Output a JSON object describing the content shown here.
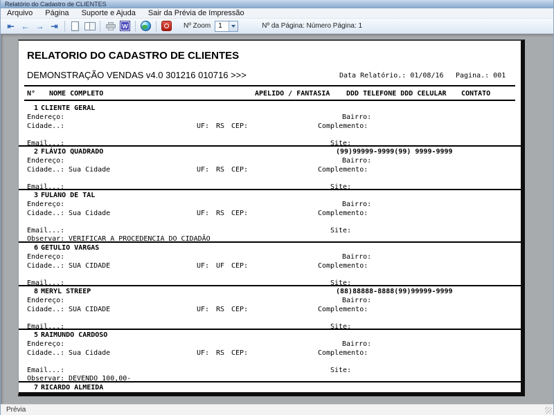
{
  "window": {
    "title": "Relatório do Cadastro de CLIENTES"
  },
  "menu": {
    "items": [
      "Arquivo",
      "Página",
      "Suporte e Ajuda",
      "Sair da Prévia de Impressão"
    ]
  },
  "toolbar": {
    "nav": {
      "first": "⇤",
      "prev": "←",
      "next": "→",
      "last": "⇥"
    },
    "word_letter": "W",
    "zoom_label": "Nº Zoom",
    "zoom_value": "1",
    "page_info": "Nº da Página: Número Página: 1"
  },
  "report": {
    "title": "RELATORIO DO CADASTRO DE CLIENTES",
    "subtitle": "DEMONSTRAÇÃO VENDAS v4.0 301216 010716 >>>",
    "date_label": "Data Relatório.: 01/08/16",
    "page_label": "Pagina.: 001",
    "columns": {
      "num": "N°",
      "nome": "NOME COMPLETO",
      "apelido": "APELIDO / FANTASIA",
      "telefone": "DDD TELEFONE DDD CELULAR",
      "contato": "CONTATO"
    },
    "labels": {
      "endereco": "Endereço:",
      "bairro": "Bairro:",
      "cidade": "Cidade..:",
      "uf": "UF:",
      "cep": "CEP:",
      "complemento": "Complemento:",
      "email": "Email...:",
      "site": "Site:",
      "observar": "Observar:"
    },
    "records": [
      {
        "num": "1",
        "name": "CLIENTE GERAL",
        "phone": "",
        "cidade": "",
        "uf": "RS",
        "observar": ""
      },
      {
        "num": "2",
        "name": "FLÁVIO QUADRADO",
        "phone": "(99)99999-9999(99) 9999-9999",
        "cidade": "Sua Cidade",
        "uf": "RS",
        "observar": ""
      },
      {
        "num": "3",
        "name": "FULANO DE TAL",
        "phone": "",
        "cidade": "Sua Cidade",
        "uf": "RS",
        "observar": "VERIFICAR A PROCEDENCIA DO CIDADÃO"
      },
      {
        "num": "6",
        "name": "GETULIO VARGAS",
        "phone": "",
        "cidade": "SUA CIDADE",
        "uf": "UF",
        "observar": ""
      },
      {
        "num": "8",
        "name": "MERYL STREEP",
        "phone": "(88)88888-8888(99)99999-9999",
        "cidade": "SUA CIDADE",
        "uf": "RS",
        "observar": ""
      },
      {
        "num": "5",
        "name": "RAIMUNDO CARDOSO",
        "phone": "",
        "cidade": "Sua Cidade",
        "uf": "RS",
        "observar": "DEVENDO 100,00-"
      },
      {
        "num": "7",
        "name": "RICARDO ALMEIDA",
        "phone": "",
        "cidade": "",
        "uf": "",
        "observar": "",
        "partial": true
      }
    ]
  },
  "statusbar": {
    "text": "Prévia"
  }
}
